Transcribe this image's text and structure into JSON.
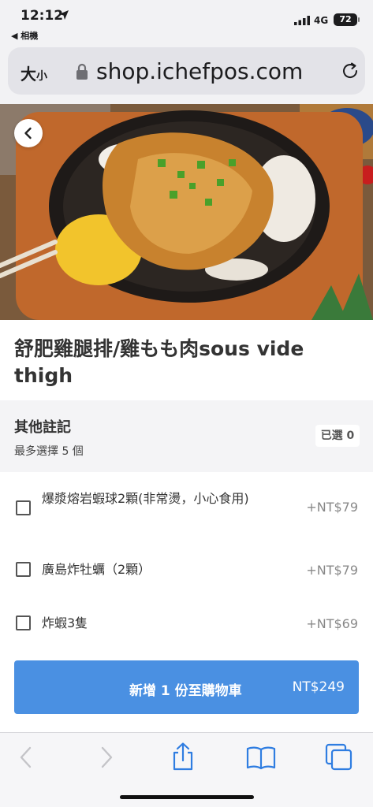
{
  "status_bar": {
    "time": "12:12",
    "back_app": "◀ 相機",
    "network": "4G",
    "battery": "72"
  },
  "browser": {
    "text_size_label": "大",
    "text_size_small": "小",
    "url": "shop.ichefpos.com"
  },
  "product": {
    "title": "舒肥雞腿排/雞もも肉sous vide thigh"
  },
  "options_section": {
    "title": "其他註記",
    "subtitle": "最多選擇 5 個",
    "selected_badge": "已選 0",
    "items": [
      {
        "label": "爆漿熔岩蝦球2顆(非常燙，小心食用)",
        "price": "+NT$79",
        "checked": false
      },
      {
        "label": "廣島炸牡蠣（2顆）",
        "price": "+NT$79",
        "checked": false
      },
      {
        "label": "炸蝦3隻",
        "price": "+NT$69",
        "checked": false
      }
    ]
  },
  "cart_button": {
    "label": "新增 1 份至購物車",
    "price": "NT$249"
  },
  "colors": {
    "accent": "#4a90e2",
    "toolbar_icon": "#2f7de1"
  },
  "icons": [
    "location-arrow-icon",
    "signal-icon",
    "lock-icon",
    "reload-icon",
    "back-icon",
    "nav-back-icon",
    "nav-forward-icon",
    "share-icon",
    "bookmarks-icon",
    "tabs-icon"
  ]
}
